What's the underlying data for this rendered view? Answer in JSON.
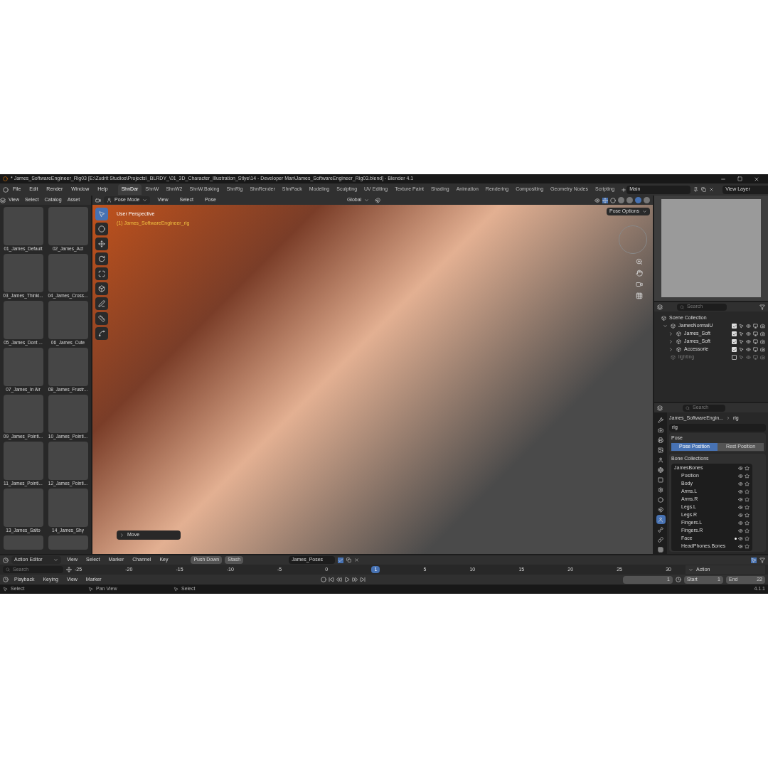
{
  "window": {
    "title": "* James_SoftwareEngineer_Rig03 [E:\\Zudrit Studios\\Projects\\_BLRDY_\\01_3D_Character_Illustration_Stlye\\14 - Developer Man\\James_SoftwareEngineer_Rig03.blend] - Blender 4.1"
  },
  "menu": [
    "File",
    "Edit",
    "Render",
    "Window",
    "Help"
  ],
  "workspaces": [
    {
      "label": "ShnDar",
      "selected": true
    },
    {
      "label": "ShnW",
      "selected": false
    },
    {
      "label": "ShnW2",
      "selected": false
    },
    {
      "label": "ShnW.Baking",
      "selected": false
    },
    {
      "label": "ShnRig",
      "selected": false
    },
    {
      "label": "ShnRender",
      "selected": false
    },
    {
      "label": "ShnPack",
      "selected": false
    },
    {
      "label": "Modeling",
      "selected": false
    },
    {
      "label": "Sculpting",
      "selected": false
    },
    {
      "label": "UV Editing",
      "selected": false
    },
    {
      "label": "Texture Paint",
      "selected": false
    },
    {
      "label": "Shading",
      "selected": false
    },
    {
      "label": "Animation",
      "selected": false
    },
    {
      "label": "Rendering",
      "selected": false
    },
    {
      "label": "Compositing",
      "selected": false
    },
    {
      "label": "Geometry Nodes",
      "selected": false
    },
    {
      "label": "Scripting",
      "selected": false
    }
  ],
  "scene": "Main",
  "view_layer": "View Layer",
  "asset_browser": {
    "menus": [
      "View",
      "Select",
      "Catalog",
      "Asset"
    ],
    "assets": [
      "01_James_Default",
      "02_James_Act",
      "03_James_Thinki...",
      "04_James_Cross...",
      "05_James_Dont ...",
      "06_James_Cute",
      "07_James_In Air",
      "08_James_Frustr...",
      "09_James_Pointi...",
      "10_James_Pointi...",
      "11_James_Pointi...",
      "12_James_Pointi...",
      "13_James_Salto",
      "14_James_Shy"
    ]
  },
  "viewport": {
    "mode": "Pose Mode",
    "menus": [
      "View",
      "Select",
      "Pose"
    ],
    "orientation": "Global",
    "pose_options": "Pose Options",
    "view_name": "User Perspective",
    "object_info": "(1) James_SoftwareEngineer_rig",
    "last_operator": "Move",
    "tools": [
      {
        "selected": true
      },
      {
        "selected": false
      },
      {
        "selected": false
      },
      {
        "selected": false
      },
      {
        "selected": false
      },
      {
        "selected": false
      },
      {
        "selected": false
      },
      {
        "selected": false
      },
      {
        "selected": false
      }
    ],
    "shading": [
      {
        "selected": false
      },
      {
        "selected": false
      },
      {
        "selected": true
      },
      {
        "selected": false
      }
    ]
  },
  "outliner": {
    "placeholder": "Search",
    "items": [
      {
        "name": "Scene Collection",
        "children": [
          {
            "name": "JamesNormalU",
            "checked": true,
            "disabled": false,
            "expanded": true,
            "children": [
              {
                "name": "James_Soft",
                "checked": true,
                "disabled": false,
                "expanded": false
              },
              {
                "name": "James_Soft",
                "checked": true,
                "disabled": false,
                "expanded": false
              },
              {
                "name": "Accessorie",
                "checked": true,
                "disabled": false,
                "expanded": false
              }
            ]
          },
          {
            "name": "lighting",
            "checked": false,
            "disabled": true
          }
        ]
      }
    ]
  },
  "properties": {
    "placeholder": "Search",
    "tabs": [
      {
        "selected": false
      },
      {
        "selected": false
      },
      {
        "selected": false
      },
      {
        "selected": false
      },
      {
        "selected": false
      },
      {
        "selected": false
      },
      {
        "selected": false
      },
      {
        "selected": false
      },
      {
        "selected": false
      },
      {
        "selected": false
      },
      {
        "selected": true
      },
      {
        "selected": false
      },
      {
        "selected": false
      },
      {
        "selected": false
      }
    ],
    "breadcrumb": [
      "James_SoftwareEngin...",
      "rig"
    ],
    "data_name": "rig",
    "pose_panel": {
      "title": "Pose",
      "buttons": [
        {
          "label": "Pose Position",
          "selected": true
        },
        {
          "label": "Rest Position",
          "selected": false
        }
      ]
    },
    "bone_panel": {
      "title": "Bone Collections",
      "root": "JamesBones",
      "collections": [
        {
          "name": "Position",
          "dot": false
        },
        {
          "name": "Body",
          "dot": false
        },
        {
          "name": "Arms.L",
          "dot": false
        },
        {
          "name": "Arms.R",
          "dot": false
        },
        {
          "name": "Legs.L",
          "dot": false
        },
        {
          "name": "Legs.R",
          "dot": false
        },
        {
          "name": "Fingers.L",
          "dot": false
        },
        {
          "name": "Fingers.R",
          "dot": false
        },
        {
          "name": "Face",
          "dot": true
        },
        {
          "name": "HeadPhones.Bones",
          "dot": false
        }
      ]
    }
  },
  "action_editor": {
    "editor": "Action Editor",
    "menus": [
      "View",
      "Select",
      "Marker",
      "Channel",
      "Key"
    ],
    "push_down": "Push Down",
    "stash": "Stash",
    "action": "James_Poses",
    "placeholder": "Search",
    "ticks": [
      "-25",
      "-20",
      "-15",
      "-10",
      "-5",
      "0"
    ],
    "current": "1",
    "ticks_after": [
      "5",
      "10",
      "15",
      "20",
      "25",
      "30"
    ],
    "side_panel": "Action"
  },
  "timeline": {
    "menus": [
      "Playback",
      "Keying",
      "View",
      "Marker"
    ],
    "frame": "1",
    "start_label": "Start",
    "start": "1",
    "end_label": "End",
    "end": "22"
  },
  "status_bar": {
    "items": [
      "Select",
      "Pan View",
      "Select"
    ],
    "version": "4.1.1"
  }
}
